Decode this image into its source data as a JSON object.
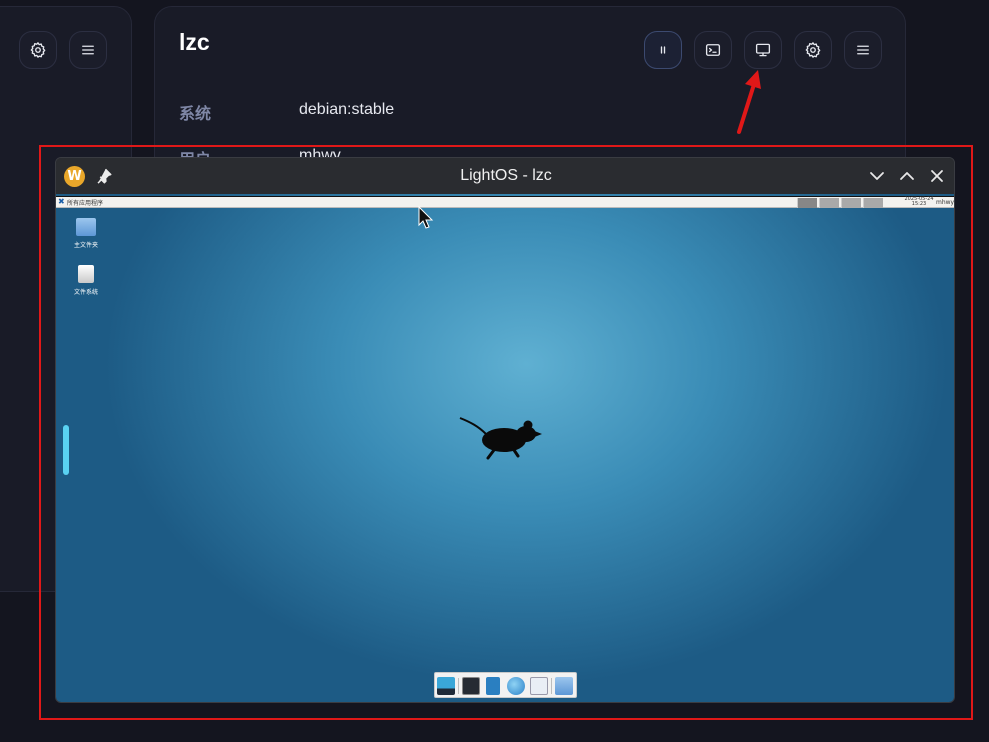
{
  "card": {
    "title": "lzc",
    "info": [
      {
        "label": "系统",
        "value": "debian:stable"
      },
      {
        "label": "用户",
        "value": "mhwy"
      }
    ]
  },
  "icons": {
    "left_card": [
      "gear-icon",
      "menu-icon"
    ],
    "main_card": [
      "pause-icon",
      "terminal-icon",
      "monitor-icon",
      "gear-icon",
      "menu-icon"
    ]
  },
  "window": {
    "title": "LightOS - lzc",
    "logo_letter": "W"
  },
  "desktop": {
    "panel_apps": "所有应用程序",
    "clock": "2025-05-24 15:23",
    "user": "mhwy",
    "icons": [
      {
        "label": "主文件夹"
      },
      {
        "label": "文件系统"
      }
    ]
  },
  "colors": {
    "annotation_red": "#e01818",
    "accent_cyan": "#5ad2f2",
    "desktop_blue": "#3a8cb6"
  }
}
